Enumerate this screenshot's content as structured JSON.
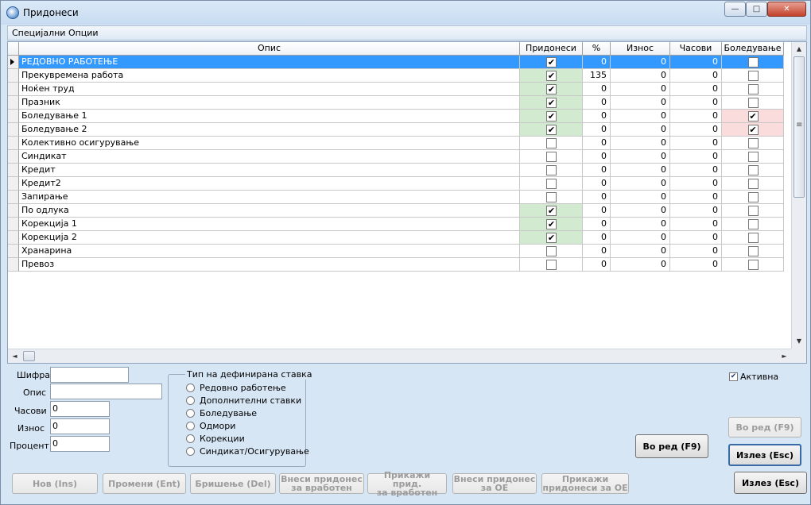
{
  "window": {
    "title": "Придонеси",
    "min_glyph": "—",
    "max_glyph": "□",
    "close_glyph": "✕"
  },
  "menu": {
    "special_options": "Специјални Опции"
  },
  "grid": {
    "columns": {
      "opis": "Опис",
      "pridonesi": "Придонеси",
      "pct": "%",
      "iznos": "Износ",
      "chasovi": "Часови",
      "boleduvanje": "Боледување"
    },
    "rows": [
      {
        "opis": "РЕДОВНО РАБОТЕЊЕ",
        "pridonesi": true,
        "pct": "0",
        "iznos": "0",
        "chasovi": "0",
        "boleduvanje": false
      },
      {
        "opis": "Прекувремена работа",
        "pridonesi": true,
        "pct": "135",
        "iznos": "0",
        "chasovi": "0",
        "boleduvanje": false
      },
      {
        "opis": "Ноќен труд",
        "pridonesi": true,
        "pct": "0",
        "iznos": "0",
        "chasovi": "0",
        "boleduvanje": false
      },
      {
        "opis": "Празник",
        "pridonesi": true,
        "pct": "0",
        "iznos": "0",
        "chasovi": "0",
        "boleduvanje": false
      },
      {
        "opis": "Боледување 1",
        "pridonesi": true,
        "pct": "0",
        "iznos": "0",
        "chasovi": "0",
        "boleduvanje": true
      },
      {
        "opis": "Боледување 2",
        "pridonesi": true,
        "pct": "0",
        "iznos": "0",
        "chasovi": "0",
        "boleduvanje": true
      },
      {
        "opis": "Колективно осигурување",
        "pridonesi": false,
        "pct": "0",
        "iznos": "0",
        "chasovi": "0",
        "boleduvanje": false
      },
      {
        "opis": "Синдикат",
        "pridonesi": false,
        "pct": "0",
        "iznos": "0",
        "chasovi": "0",
        "boleduvanje": false
      },
      {
        "opis": "Кредит",
        "pridonesi": false,
        "pct": "0",
        "iznos": "0",
        "chasovi": "0",
        "boleduvanje": false
      },
      {
        "opis": "Кредит2",
        "pridonesi": false,
        "pct": "0",
        "iznos": "0",
        "chasovi": "0",
        "boleduvanje": false
      },
      {
        "opis": "Запирање",
        "pridonesi": false,
        "pct": "0",
        "iznos": "0",
        "chasovi": "0",
        "boleduvanje": false
      },
      {
        "opis": "По одлука",
        "pridonesi": true,
        "pct": "0",
        "iznos": "0",
        "chasovi": "0",
        "boleduvanje": false
      },
      {
        "opis": "Корекција 1",
        "pridonesi": true,
        "pct": "0",
        "iznos": "0",
        "chasovi": "0",
        "boleduvanje": false
      },
      {
        "opis": "Корекција 2",
        "pridonesi": true,
        "pct": "0",
        "iznos": "0",
        "chasovi": "0",
        "boleduvanje": false
      },
      {
        "opis": "Хранарина",
        "pridonesi": false,
        "pct": "0",
        "iznos": "0",
        "chasovi": "0",
        "boleduvanje": false
      },
      {
        "opis": "Превоз",
        "pridonesi": false,
        "pct": "0",
        "iznos": "0",
        "chasovi": "0",
        "boleduvanje": false
      }
    ],
    "selected_row": 0,
    "check_glyph": "✔",
    "colors": {
      "selected": "#3399ff",
      "green_highlight": "#d2eacf",
      "pink_highlight": "#fbdcdc"
    }
  },
  "scroll": {
    "up": "▲",
    "down": "▼",
    "left": "◄",
    "right": "►",
    "grip": "≡"
  },
  "form": {
    "shifra_label": "Шифра",
    "shifra_value": "",
    "opis_label": "Опис",
    "opis_value": "",
    "chasovi_label": "Часови",
    "chasovi_value": "0",
    "iznos_label": "Износ",
    "iznos_value": "0",
    "procent_label": "Процент",
    "procent_value": "0"
  },
  "type_group": {
    "title": "Тип на дефинирана ставка",
    "options": [
      "Редовно работење",
      "Дополнителни ставки",
      "Боледување",
      "Одмори",
      "Корекции",
      "Синдикат/Осигурување"
    ]
  },
  "active": {
    "label": "Активна",
    "checked": true,
    "glyph": "✔"
  },
  "buttons": {
    "vo_red_main": "Во ред (F9)",
    "vo_red_right": "Во ред (F9)",
    "izlez_right": "Излез (Esc)",
    "nov": "Нов (Ins)",
    "promeni": "Промени (Ent)",
    "brishenje": "Бришење (Del)",
    "vnesi_vraboten_1": "Внеси придонес",
    "vnesi_vraboten_2": "за вработен",
    "prikazi_vraboten_1": "Прикажи прид.",
    "prikazi_vraboten_2": "за вработен",
    "vnesi_oe_1": "Внеси придонес",
    "vnesi_oe_2": "за ОЕ",
    "prikazi_oe_1": "Прикажи",
    "prikazi_oe_2": "придонеси за ОЕ",
    "izlez_bottom": "Излез (Esc)"
  }
}
